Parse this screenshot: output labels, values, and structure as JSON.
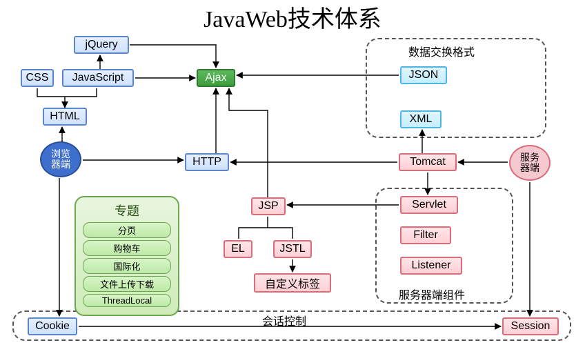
{
  "title": "JavaWeb技术体系",
  "nodes": {
    "jquery": "jQuery",
    "css": "CSS",
    "javascript": "JavaScript",
    "ajax": "Ajax",
    "html": "HTML",
    "browser": "浏览\n器端",
    "http": "HTTP",
    "jsp": "JSP",
    "el": "EL",
    "jstl": "JSTL",
    "custom_tag": "自定义标签",
    "json": "JSON",
    "xml": "XML",
    "tomcat": "Tomcat",
    "servlet": "Servlet",
    "filter": "Filter",
    "listener": "Listener",
    "server": "服务\n器端",
    "cookie": "Cookie",
    "session": "Session"
  },
  "groups": {
    "data_format": "数据交换格式",
    "server_components": "服务器端组件",
    "session_control": "会话控制"
  },
  "topics": {
    "title": "专题",
    "items": [
      "分页",
      "购物车",
      "国际化",
      "文件上传下载",
      "ThreadLocal"
    ]
  }
}
